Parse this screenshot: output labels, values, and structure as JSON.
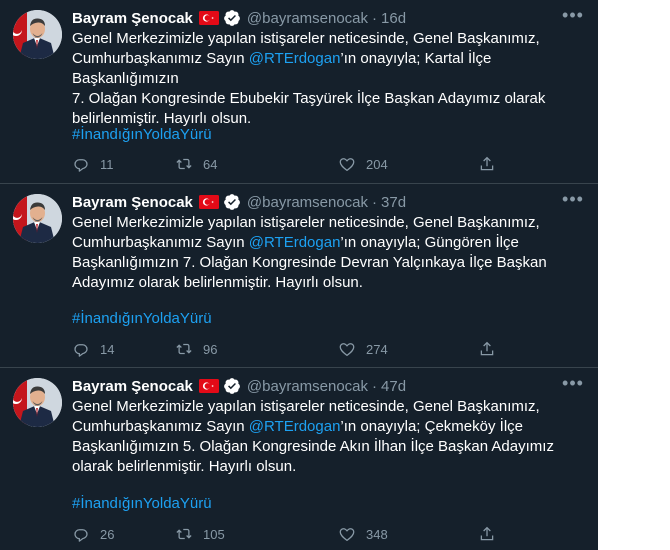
{
  "tweets": [
    {
      "name": "Bayram Şenocak",
      "handle": "@bayramsenocak",
      "separator": "·",
      "time": "16d",
      "lines": [
        {
          "pre": "Genel Merkezimizle yapılan istişareler neticesinde, Genel Başkanımız,",
          "mention": "",
          "post": ""
        },
        {
          "pre": "Cumhurbaşkanımız Sayın ",
          "mention": "@RTErdogan",
          "post": "’ın onayıyla; Kartal İlçe Başkanlığımızın"
        },
        {
          "pre": "7. Olağan Kongresinde Ebubekir Taşyürek İlçe Başkan Adayımız olarak",
          "mention": "",
          "post": ""
        },
        {
          "pre": "belirlenmiştir. Hayırlı olsun.",
          "mention": "",
          "post": ""
        }
      ],
      "hashtag": "#İnandığınYoldaYürü",
      "replies": "11",
      "retweets": "64",
      "likes": "204"
    },
    {
      "name": "Bayram Şenocak",
      "handle": "@bayramsenocak",
      "separator": "·",
      "time": "37d",
      "lines": [
        {
          "pre": "Genel Merkezimizle yapılan istişareler neticesinde, Genel Başkanımız,",
          "mention": "",
          "post": ""
        },
        {
          "pre": "Cumhurbaşkanımız Sayın ",
          "mention": "@RTErdogan",
          "post": "’ın onayıyla; Güngören İlçe"
        },
        {
          "pre": "Başkanlığımızın 7. Olağan Kongresinde Devran Yalçınkaya İlçe Başkan",
          "mention": "",
          "post": ""
        },
        {
          "pre": "Adayımız olarak belirlenmiştir. Hayırlı olsun.",
          "mention": "",
          "post": ""
        }
      ],
      "hashtag": "#İnandığınYoldaYürü",
      "replies": "14",
      "retweets": "96",
      "likes": "274"
    },
    {
      "name": "Bayram Şenocak",
      "handle": "@bayramsenocak",
      "separator": "·",
      "time": "47d",
      "lines": [
        {
          "pre": "Genel Merkezimizle yapılan istişareler neticesinde, Genel Başkanımız,",
          "mention": "",
          "post": ""
        },
        {
          "pre": "Cumhurbaşkanımız Sayın ",
          "mention": "@RTErdogan",
          "post": "’ın onayıyla; Çekmeköy İlçe"
        },
        {
          "pre": "Başkanlığımızın 5. Olağan Kongresinde Akın İlhan İlçe Başkan Adayımız",
          "mention": "",
          "post": ""
        },
        {
          "pre": "olarak belirlenmiştir. Hayırlı olsun.",
          "mention": "",
          "post": ""
        }
      ],
      "hashtag": "#İnandığınYoldaYürü",
      "replies": "26",
      "retweets": "105",
      "likes": "348"
    }
  ],
  "icons": {
    "more": "more-options-icon",
    "reply": "reply-icon",
    "retweet": "retweet-icon",
    "like": "like-icon",
    "share": "share-icon",
    "flag": "turkey-flag-icon",
    "verified": "verified-badge-icon"
  },
  "colors": {
    "background": "#15202b",
    "divider": "#38444d",
    "text": "#ffffff",
    "secondary": "#8899a6",
    "link": "#1da1f2",
    "flag_red": "#e30a17",
    "verified_fill": "#ffffff"
  }
}
